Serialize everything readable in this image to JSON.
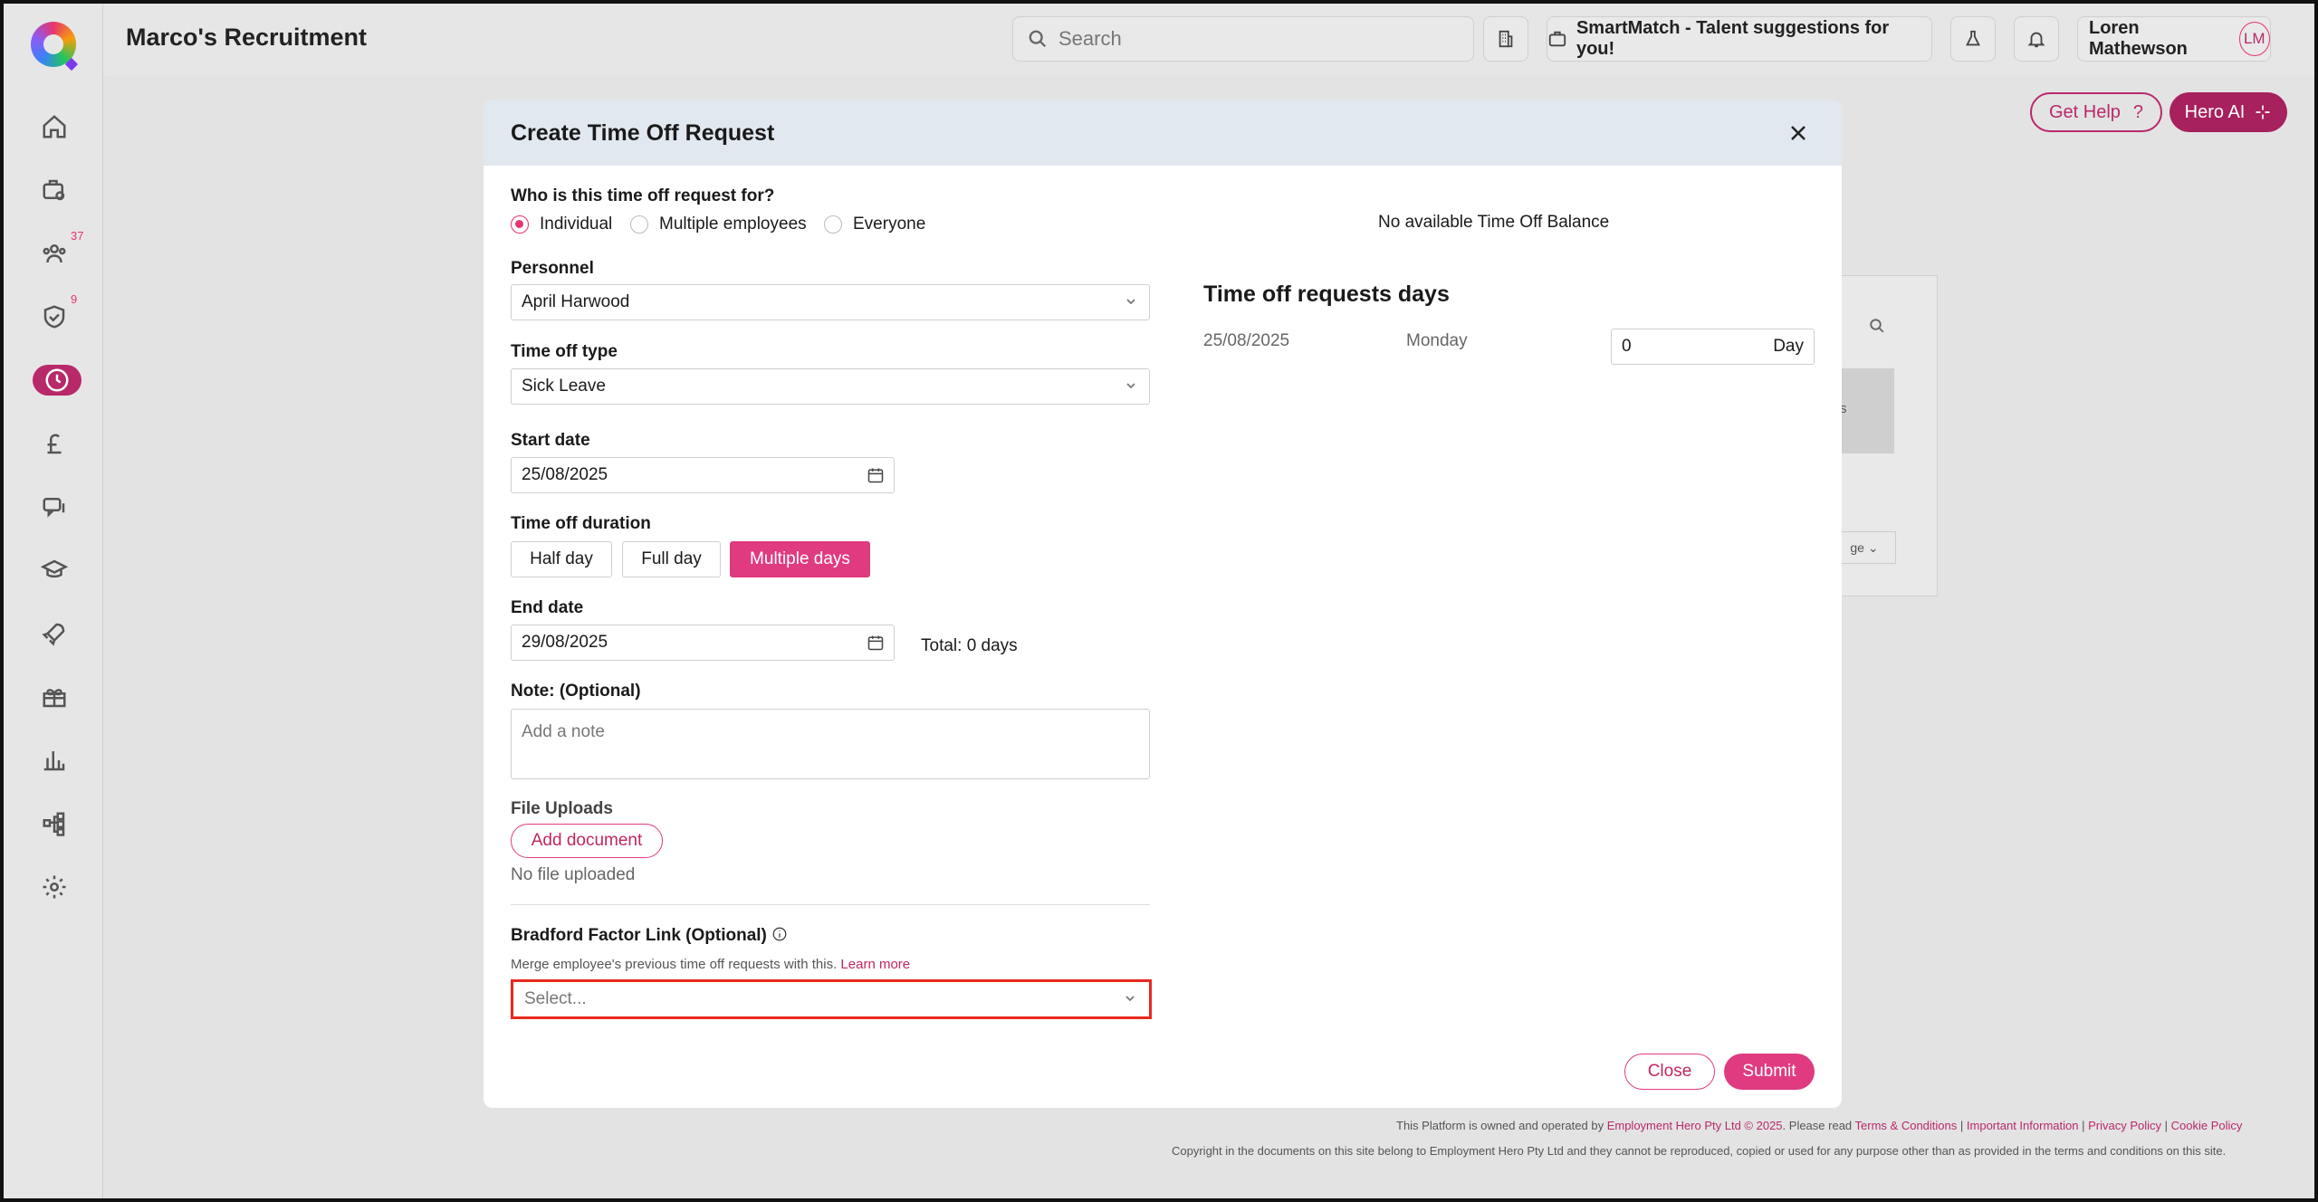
{
  "header": {
    "company": "Marco's Recruitment",
    "search_placeholder": "Search",
    "smartmatch": "SmartMatch - Talent suggestions for you!",
    "user_name": "Loren Mathewson",
    "user_initials": "LM"
  },
  "sidebar": {
    "badges": {
      "people": "37",
      "compliance": "9"
    }
  },
  "page": {
    "get_help": "Get Help",
    "get_help_q": "?",
    "hero_ai": "Hero AI",
    "bg_fragment_1": "s",
    "bg_fragment_2": "ge"
  },
  "footer": {
    "owned_prefix": "This Platform is owned and operated by",
    "owner": "Employment Hero Pty Ltd © 2025",
    "read": ". Please read",
    "terms": "Terms & Conditions",
    "important": "Important Information",
    "privacy": "Privacy Policy",
    "cookie": "Cookie Policy",
    "sep": "|",
    "copyright": "Copyright in the documents on this site belong to Employment Hero Pty Ltd and they cannot be reproduced, copied or used for any purpose other than as provided in the terms and conditions on this site."
  },
  "modal": {
    "title": "Create Time Off Request",
    "who_label": "Who is this time off request for?",
    "who_options": [
      "Individual",
      "Multiple employees",
      "Everyone"
    ],
    "who_selected": "Individual",
    "personnel_label": "Personnel",
    "personnel_value": "April Harwood",
    "type_label": "Time off type",
    "type_value": "Sick Leave",
    "start_label": "Start date",
    "start_value": "25/08/2025",
    "duration_label": "Time off duration",
    "duration_options": [
      "Half day",
      "Full day",
      "Multiple days"
    ],
    "duration_selected": "Multiple days",
    "end_label": "End date",
    "end_value": "29/08/2025",
    "total": "Total: 0 days",
    "note_label": "Note: (Optional)",
    "note_placeholder": "Add a note",
    "uploads_label": "File Uploads",
    "add_document": "Add document",
    "no_file": "No file uploaded",
    "bradford_label": "Bradford Factor Link (Optional)",
    "bradford_help": "Merge employee's previous time off requests with this.",
    "learn_more": "Learn more",
    "bradford_placeholder": "Select...",
    "balance": "No available Time Off Balance",
    "days_title": "Time off requests days",
    "days": [
      {
        "date": "25/08/2025",
        "weekday": "Monday",
        "value": "0",
        "unit": "Day"
      }
    ],
    "close": "Close",
    "submit": "Submit"
  }
}
